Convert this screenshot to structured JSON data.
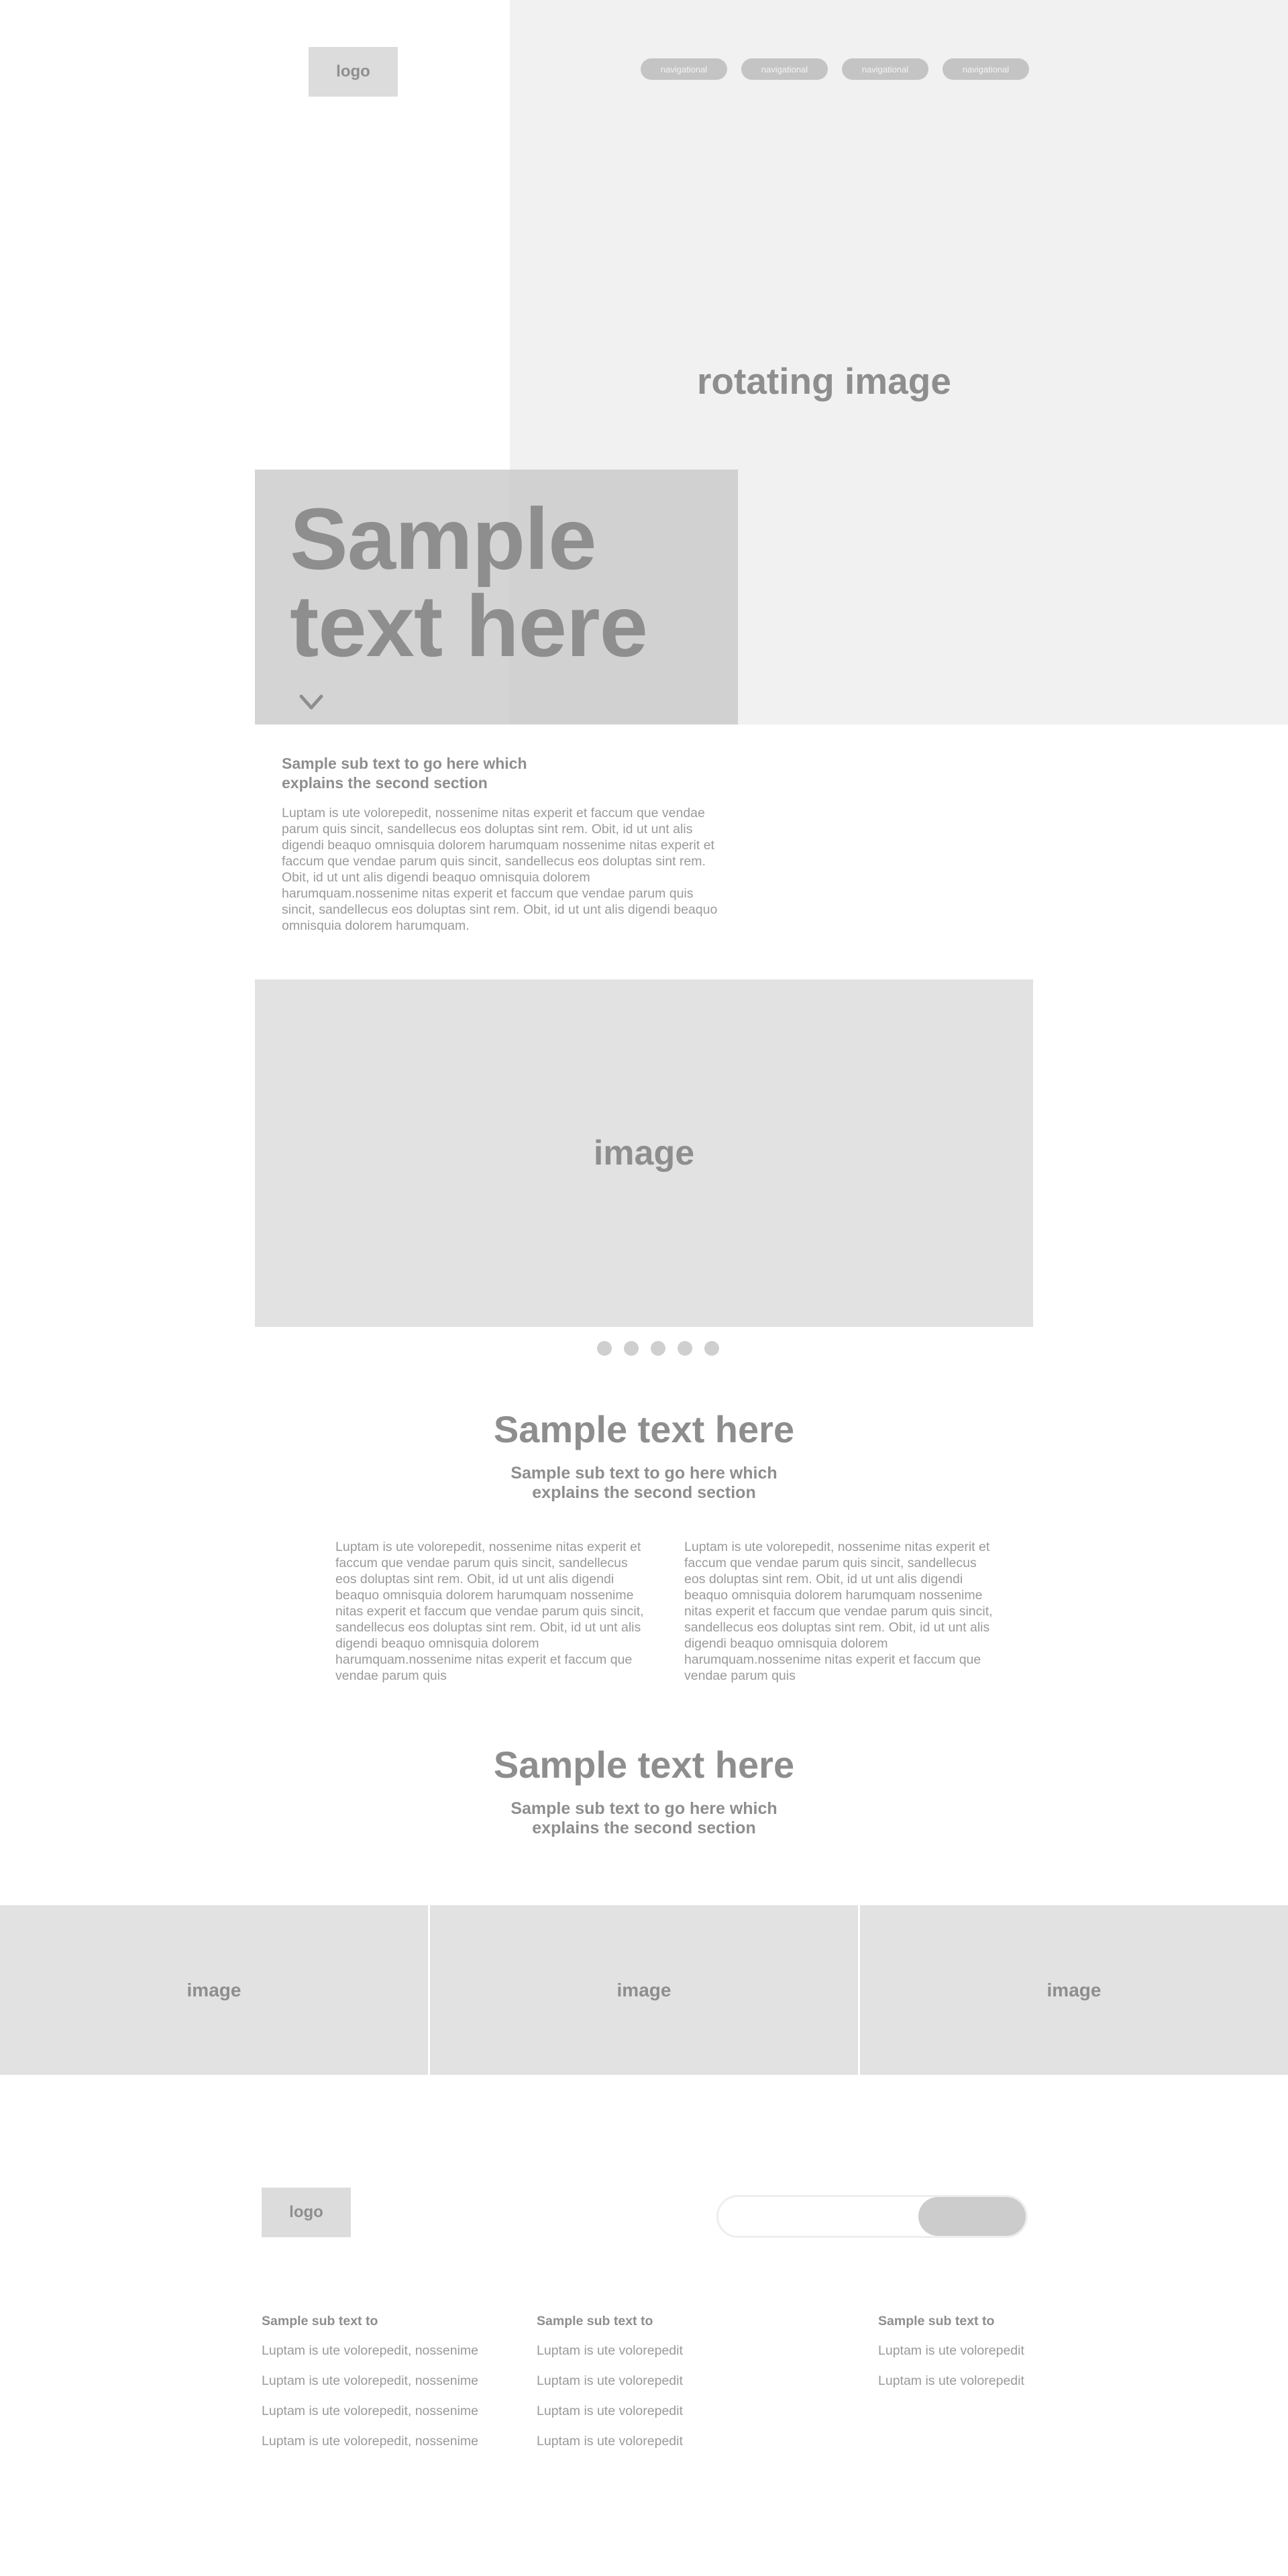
{
  "header": {
    "logo_text": "logo",
    "nav": [
      "navigational",
      "navigational",
      "navigational",
      "navigational"
    ]
  },
  "hero": {
    "rotating_label": "rotating image",
    "title": "Sample text here",
    "scroll_icon": "chevron-down-icon"
  },
  "intro": {
    "subheading": "Sample sub text to go here which explains the second section",
    "body": "Luptam is ute volorepedit, nossenime nitas experit et faccum que vendae parum quis sincit, sandellecus eos doluptas sint rem. Obit, id ut unt alis digendi beaquo omnisquia dolorem harumquam nossenime nitas experit et faccum que vendae parum quis sincit, sandellecus eos doluptas sint rem. Obit, id ut unt alis digendi beaquo omnisquia dolorem harumquam.nossenime nitas experit et faccum que vendae parum quis sincit, sandellecus eos doluptas sint rem. Obit, id ut unt alis digendi beaquo omnisquia dolorem harumquam."
  },
  "carousel": {
    "image_label": "image",
    "slide_count": 5
  },
  "section_two": {
    "title": "Sample text here",
    "subheading": "Sample sub text to go here which explains the second section",
    "col_left": "Luptam is ute volorepedit, nossenime nitas experit et faccum que vendae parum quis sincit, sandellecus eos doluptas sint rem. Obit, id ut unt alis digendi beaquo omnisquia dolorem harumquam nossenime nitas experit et faccum que vendae parum quis sincit, sandellecus eos doluptas sint rem. Obit, id ut unt alis digendi beaquo omnisquia dolorem harumquam.nossenime nitas experit et faccum que vendae parum quis",
    "col_right": "Luptam is ute volorepedit, nossenime nitas experit et faccum que vendae parum quis sincit, sandellecus eos doluptas sint rem. Obit, id ut unt alis digendi beaquo omnisquia dolorem harumquam nossenime nitas experit et faccum que vendae parum quis sincit, sandellecus eos doluptas sint rem. Obit, id ut unt alis digendi beaquo omnisquia dolorem harumquam.nossenime nitas experit et faccum que vendae parum quis"
  },
  "section_three": {
    "title": "Sample text here",
    "subheading": "Sample sub text to go here which explains the second section"
  },
  "image_strip": [
    "image",
    "image",
    "image"
  ],
  "footer": {
    "logo_text": "logo",
    "columns": [
      {
        "heading": "Sample sub text to",
        "links": [
          "Luptam is ute volorepedit, nossenime",
          "Luptam is ute volorepedit, nossenime",
          "Luptam is ute volorepedit, nossenime",
          "Luptam is ute volorepedit, nossenime"
        ]
      },
      {
        "heading": "Sample sub text to",
        "links": [
          "Luptam is ute volorepedit",
          "Luptam is ute volorepedit",
          "Luptam is ute volorepedit",
          "Luptam is ute volorepedit"
        ]
      },
      {
        "heading": "Sample sub text to",
        "links": [
          "Luptam is ute volorepedit",
          "Luptam is ute volorepedit"
        ]
      }
    ]
  },
  "colors": {
    "placeholder": "#e2e2e2",
    "hero_bg": "#f1f1f1",
    "text": "#8e8e8e",
    "pill": "#c4c4c4"
  }
}
